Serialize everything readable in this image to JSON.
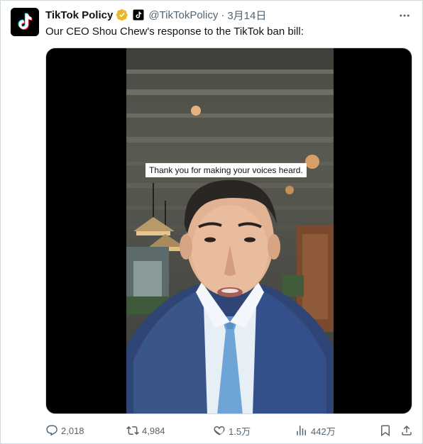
{
  "tweet": {
    "author_name": "TikTok Policy",
    "handle": "@TikTokPolicy",
    "separator": "·",
    "date": "3月14日",
    "text": "Our CEO Shou Chew's response to the TikTok ban bill:",
    "verified_color": "#e8b829",
    "avatar_icon": "tiktok-logo",
    "more_icon": "more-horizontal"
  },
  "media": {
    "caption": "Thank you for making your voices heard.",
    "kind": "video"
  },
  "actions": {
    "replies": "2,018",
    "reposts": "4,984",
    "likes": "1.5万",
    "views": "442万"
  },
  "colors": {
    "text_primary": "#0f1419",
    "text_secondary": "#536471",
    "border": "#cfd9de"
  }
}
